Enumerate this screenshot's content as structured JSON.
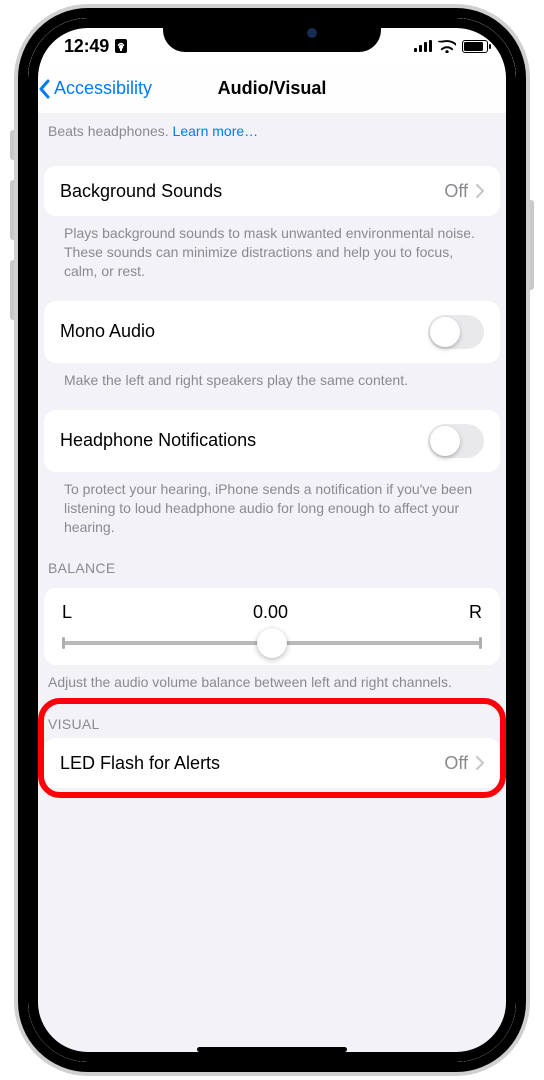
{
  "status": {
    "time": "12:49",
    "portrait_lock": "▯"
  },
  "nav": {
    "back_label": "Accessibility",
    "title": "Audio/Visual"
  },
  "top_helper": {
    "prefix": "Beats headphones. ",
    "learn_more": "Learn more…"
  },
  "background_sounds": {
    "label": "Background Sounds",
    "value": "Off",
    "footer": "Plays background sounds to mask unwanted environmental noise. These sounds can minimize distractions and help you to focus, calm, or rest."
  },
  "mono_audio": {
    "label": "Mono Audio",
    "footer": "Make the left and right speakers play the same content."
  },
  "headphone_notifications": {
    "label": "Headphone Notifications",
    "footer": "To protect your hearing, iPhone sends a notification if you've been listening to loud headphone audio for long enough to affect your hearing."
  },
  "balance": {
    "header": "BALANCE",
    "left": "L",
    "right": "R",
    "value": "0.00",
    "footer": "Adjust the audio volume balance between left and right channels."
  },
  "visual": {
    "header": "VISUAL"
  },
  "led_flash": {
    "label": "LED Flash for Alerts",
    "value": "Off"
  }
}
